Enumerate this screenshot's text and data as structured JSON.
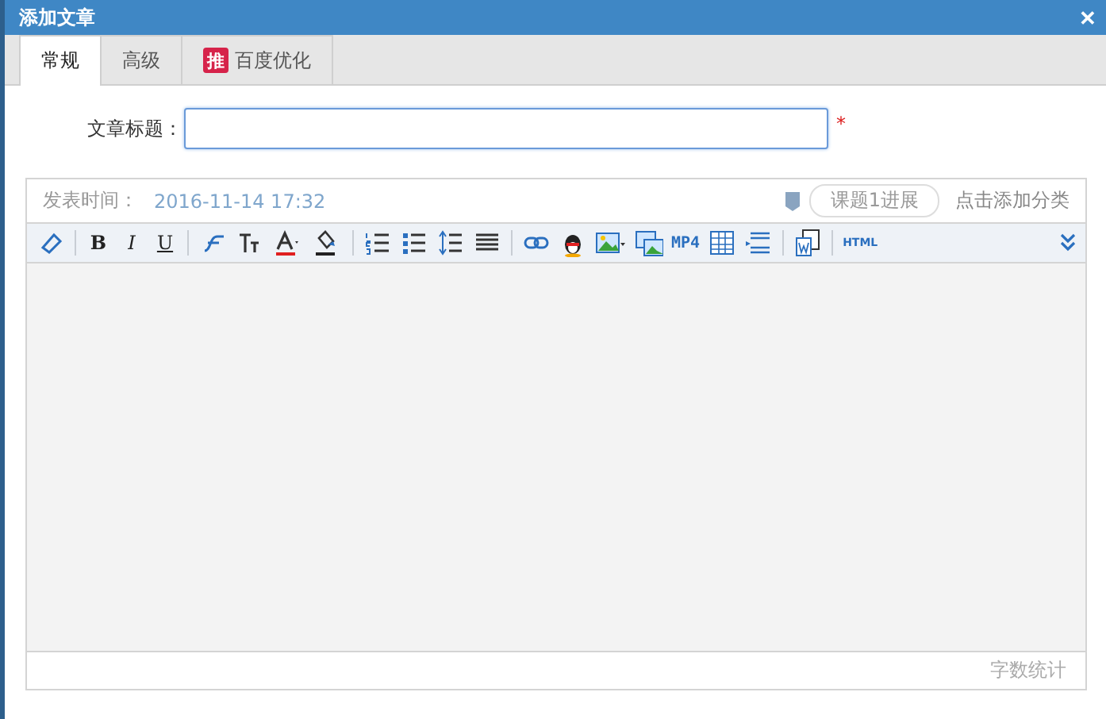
{
  "window": {
    "title": "添加文章",
    "close": "✕"
  },
  "tabs": [
    {
      "label": "常规",
      "selected": true
    },
    {
      "label": "高级",
      "selected": false
    },
    {
      "label": "百度优化",
      "selected": false,
      "badge": "推"
    }
  ],
  "title_field": {
    "label": "文章标题：",
    "required": "*"
  },
  "editor": {
    "publish_label": "发表时间：",
    "publish_time": "2016-11-14 17:32",
    "topic": "课题1进展",
    "add_category": "点击添加分类",
    "toolbar": [
      {
        "kind": "eraser"
      },
      {
        "kind": "sep"
      },
      {
        "kind": "bold",
        "label": "B"
      },
      {
        "kind": "italic",
        "label": "I"
      },
      {
        "kind": "underline",
        "label": "U"
      },
      {
        "kind": "sep"
      },
      {
        "kind": "fontfamily"
      },
      {
        "kind": "fontsize"
      },
      {
        "kind": "fontcolor"
      },
      {
        "kind": "bgcolor"
      },
      {
        "kind": "sep"
      },
      {
        "kind": "orderedlist"
      },
      {
        "kind": "bulletlist"
      },
      {
        "kind": "lineheight"
      },
      {
        "kind": "justify"
      },
      {
        "kind": "sep"
      },
      {
        "kind": "link"
      },
      {
        "kind": "qq"
      },
      {
        "kind": "image"
      },
      {
        "kind": "gallery"
      },
      {
        "kind": "video",
        "label": "MP4"
      },
      {
        "kind": "table"
      },
      {
        "kind": "pagebreak"
      },
      {
        "kind": "sep"
      },
      {
        "kind": "word"
      },
      {
        "kind": "sep"
      },
      {
        "kind": "html",
        "label": "HTML"
      }
    ],
    "word_count": "字数统计"
  }
}
